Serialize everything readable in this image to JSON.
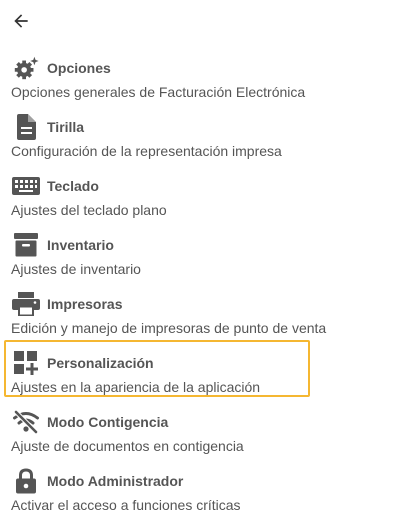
{
  "header": {
    "back_icon": "arrow-left-icon"
  },
  "colors": {
    "icon": "#555555",
    "text": "#555555",
    "back_arrow": "#333333",
    "highlight_border": "#f5b731"
  },
  "menu": {
    "items": [
      {
        "title": "Opciones",
        "description": "Opciones generales de Facturación Electrónica",
        "icon": "gears-sparkle-icon"
      },
      {
        "title": "Tirilla",
        "description": "Configuración de la representación impresa",
        "icon": "document-icon"
      },
      {
        "title": "Teclado",
        "description": "Ajustes del teclado plano",
        "icon": "keyboard-icon"
      },
      {
        "title": "Inventario",
        "description": "Ajustes de inventario",
        "icon": "archive-box-icon"
      },
      {
        "title": "Impresoras",
        "description": "Edición y manejo de impresoras de punto de venta",
        "icon": "printer-icon"
      },
      {
        "title": "Personalización",
        "description": "Ajustes en la apariencia de la aplicación",
        "icon": "dashboard-customize-icon",
        "highlighted": true
      },
      {
        "title": "Modo Contigencia",
        "description": "Ajuste de documentos en contigencia",
        "icon": "wifi-off-icon"
      },
      {
        "title": "Modo Administrador",
        "description": "Activar el acceso a funciones críticas",
        "icon": "lock-icon"
      }
    ]
  }
}
